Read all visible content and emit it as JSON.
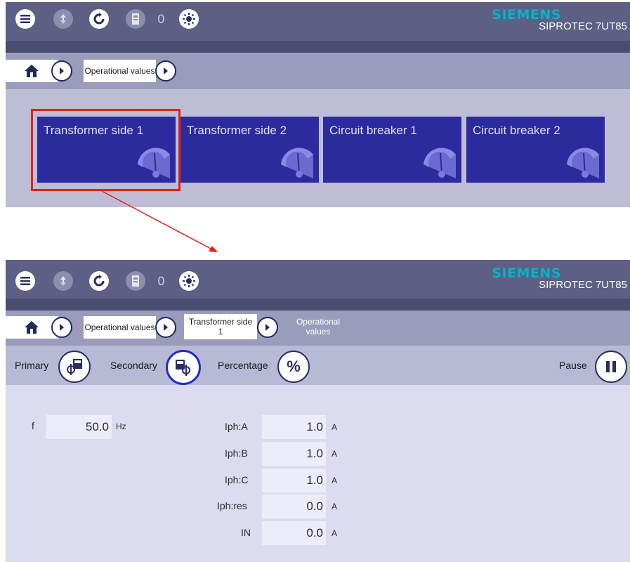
{
  "brand": {
    "company": "SIEMENS",
    "model": "SIPROTEC 7UT85"
  },
  "header": {
    "icons": [
      "menu-icon",
      "update-icon",
      "refresh-icon",
      "device-status-icon",
      "led-test-icon"
    ],
    "message_count": "0"
  },
  "screen1": {
    "breadcrumb": {
      "crumb1": "Operational values"
    },
    "tiles": [
      {
        "label": "Transformer side 1"
      },
      {
        "label": "Transformer side 2"
      },
      {
        "label": "Circuit breaker 1"
      },
      {
        "label": "Circuit breaker 2"
      }
    ]
  },
  "screen2": {
    "breadcrumb": {
      "crumb1": "Operational values",
      "crumb2_line1": "Transformer side",
      "crumb2_line2": "1",
      "crumb3": "Operational values"
    },
    "toolbar": {
      "primary": "Primary",
      "secondary": "Secondary",
      "percentage": "Percentage",
      "percentage_symbol": "%",
      "pause": "Pause",
      "selected": "Secondary"
    },
    "frequency": {
      "label": "f",
      "value": "50.0",
      "unit": "Hz"
    },
    "currents": [
      {
        "label": "Iph:A",
        "value": "1.0",
        "unit": "A"
      },
      {
        "label": "Iph:B",
        "value": "1.0",
        "unit": "A"
      },
      {
        "label": "Iph:C",
        "value": "1.0",
        "unit": "A"
      },
      {
        "label": "Iph:res",
        "value": "0.0",
        "unit": "A"
      },
      {
        "label": "IN",
        "value": "0.0",
        "unit": "A"
      }
    ]
  },
  "colors": {
    "header": "#5d5f84",
    "tile": "#2b2b9e",
    "highlight": "#e0201f",
    "brand": "#00b5c8"
  }
}
